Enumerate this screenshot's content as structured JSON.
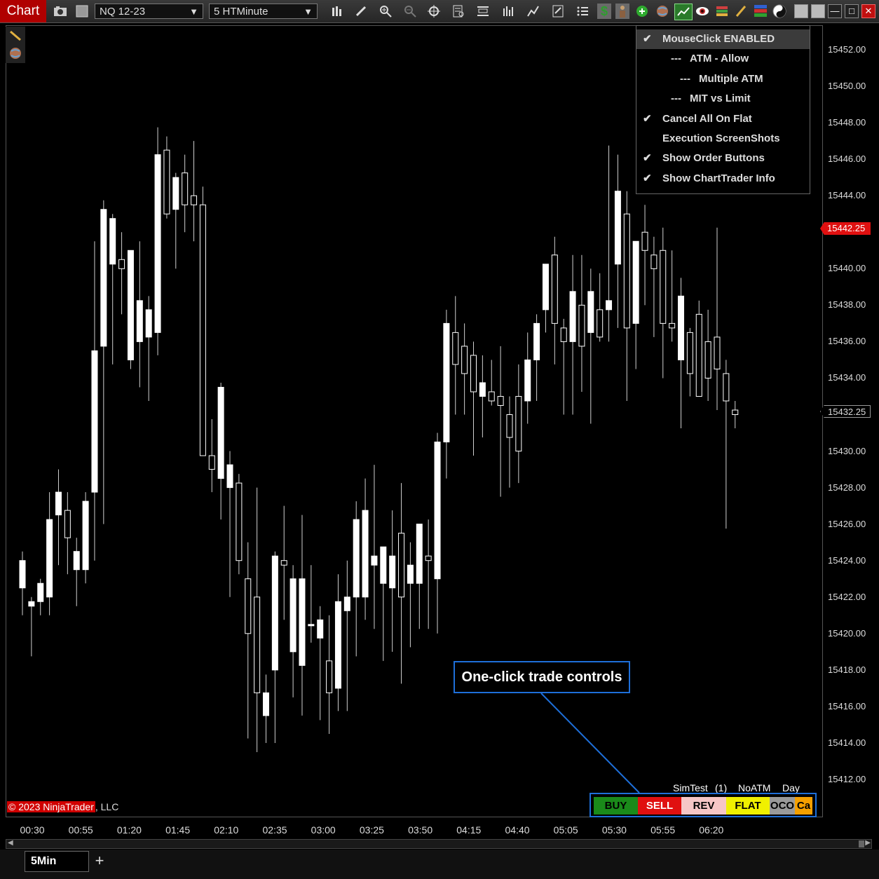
{
  "window": {
    "title": "Chart"
  },
  "toolbar": {
    "instrument": "NQ 12-23",
    "interval": "5 HTMinute",
    "icons": [
      "camera-icon",
      "square-icon",
      "bars-style-icon",
      "drawing-pencil-icon",
      "zoom-in-icon",
      "zoom-out-icon",
      "crosshair-icon",
      "data-box-icon",
      "properties-icon",
      "indicators-icon",
      "strategies-icon",
      "templates-icon",
      "order-list-icon",
      "money-icon",
      "trader-icon",
      "add-icon",
      "globe-icon",
      "chart-icon",
      "eye-icon",
      "pencil-icon",
      "bars-color-icon",
      "stack-icon",
      "yinyang-icon"
    ]
  },
  "menu": {
    "items": [
      {
        "label": "MouseClick ENABLED",
        "prefix": "",
        "checked": true
      },
      {
        "label": "ATM - Allow",
        "prefix": "---",
        "checked": false
      },
      {
        "label": "Multiple ATM",
        "prefix": "---",
        "checked": false
      },
      {
        "label": "MIT vs Limit",
        "prefix": "---",
        "checked": false
      },
      {
        "label": "Cancel All On Flat",
        "prefix": "",
        "checked": true
      },
      {
        "label": "Execution ScreenShots",
        "prefix": "",
        "checked": false
      },
      {
        "label": "Show Order Buttons",
        "prefix": "",
        "checked": true
      },
      {
        "label": "Show ChartTrader Info",
        "prefix": "",
        "checked": true
      }
    ]
  },
  "chart_data": {
    "type": "candlestick",
    "instrument": "NQ 12-23",
    "interval": "5 HTMinute",
    "yaxis_ticks": [
      "15452.00",
      "15450.00",
      "15448.00",
      "15446.00",
      "15444.00",
      "15442.00",
      "15440.00",
      "15438.00",
      "15436.00",
      "15434.00",
      "15432.00",
      "15430.00",
      "15428.00",
      "15426.00",
      "15424.00",
      "15422.00",
      "15420.00",
      "15418.00",
      "15416.00",
      "15414.00",
      "15412.00"
    ],
    "xaxis_ticks": [
      "00:30",
      "00:55",
      "01:20",
      "01:45",
      "02:10",
      "02:35",
      "03:00",
      "03:25",
      "03:50",
      "04:15",
      "04:40",
      "05:05",
      "05:30",
      "05:55",
      "06:20"
    ],
    "ylim": [
      15410.5,
      15453.5
    ],
    "price_markers": [
      {
        "label": "15442.25",
        "color": "#e00000"
      },
      {
        "label": "15432.25",
        "color": "#000000"
      }
    ],
    "candles": [
      {
        "o": 15422.5,
        "h": 15424.5,
        "l": 15421.0,
        "c": 15424.0
      },
      {
        "o": 15421.5,
        "h": 15422.0,
        "l": 15418.75,
        "c": 15421.75
      },
      {
        "o": 15421.75,
        "h": 15423.0,
        "l": 15421.0,
        "c": 15422.75
      },
      {
        "o": 15422.0,
        "h": 15427.75,
        "l": 15421.0,
        "c": 15426.25
      },
      {
        "o": 15426.5,
        "h": 15429.0,
        "l": 15423.75,
        "c": 15427.75
      },
      {
        "o": 15426.75,
        "h": 15427.75,
        "l": 15423.25,
        "c": 15425.25
      },
      {
        "o": 15423.5,
        "h": 15425.25,
        "l": 15421.5,
        "c": 15424.5
      },
      {
        "o": 15423.5,
        "h": 15427.75,
        "l": 15422.75,
        "c": 15427.25
      },
      {
        "o": 15427.75,
        "h": 15441.5,
        "l": 15424.0,
        "c": 15435.5
      },
      {
        "o": 15435.75,
        "h": 15443.75,
        "l": 15426.0,
        "c": 15443.25
      },
      {
        "o": 15440.25,
        "h": 15443.0,
        "l": 15434.75,
        "c": 15442.75
      },
      {
        "o": 15440.5,
        "h": 15442.0,
        "l": 15437.5,
        "c": 15440.0
      },
      {
        "o": 15435.0,
        "h": 15441.0,
        "l": 15434.5,
        "c": 15441.0
      },
      {
        "o": 15436.0,
        "h": 15441.5,
        "l": 15433.5,
        "c": 15438.25
      },
      {
        "o": 15436.25,
        "h": 15438.5,
        "l": 15432.75,
        "c": 15437.75
      },
      {
        "o": 15436.5,
        "h": 15447.75,
        "l": 15435.25,
        "c": 15446.25
      },
      {
        "o": 15446.5,
        "h": 15447.25,
        "l": 15442.75,
        "c": 15443.0
      },
      {
        "o": 15443.25,
        "h": 15445.25,
        "l": 15440.0,
        "c": 15445.0
      },
      {
        "o": 15445.25,
        "h": 15446.25,
        "l": 15442.0,
        "c": 15443.5
      },
      {
        "o": 15444.0,
        "h": 15447.0,
        "l": 15441.5,
        "c": 15443.5
      },
      {
        "o": 15443.5,
        "h": 15444.5,
        "l": 15431.75,
        "c": 15429.75
      },
      {
        "o": 15429.75,
        "h": 15431.75,
        "l": 15427.75,
        "c": 15429.0
      },
      {
        "o": 15428.5,
        "h": 15433.75,
        "l": 15426.25,
        "c": 15433.5
      },
      {
        "o": 15428.0,
        "h": 15430.0,
        "l": 15422.0,
        "c": 15429.25
      },
      {
        "o": 15428.25,
        "h": 15428.75,
        "l": 15423.25,
        "c": 15424.0
      },
      {
        "o": 15423.0,
        "h": 15425.0,
        "l": 15414.25,
        "c": 15420.0
      },
      {
        "o": 15422.0,
        "h": 15428.0,
        "l": 15413.5,
        "c": 15416.75
      },
      {
        "o": 15415.5,
        "h": 15417.75,
        "l": 15414.0,
        "c": 15416.75
      },
      {
        "o": 15418.0,
        "h": 15424.5,
        "l": 15414.0,
        "c": 15424.25
      },
      {
        "o": 15424.0,
        "h": 15427.0,
        "l": 15420.75,
        "c": 15423.75
      },
      {
        "o": 15419.0,
        "h": 15423.75,
        "l": 15416.5,
        "c": 15423.0
      },
      {
        "o": 15418.25,
        "h": 15426.5,
        "l": 15415.5,
        "c": 15423.0
      },
      {
        "o": 15420.5,
        "h": 15423.75,
        "l": 15419.5,
        "c": 15420.5
      },
      {
        "o": 15419.75,
        "h": 15421.5,
        "l": 15415.25,
        "c": 15420.75
      },
      {
        "o": 15418.5,
        "h": 15421.0,
        "l": 15414.5,
        "c": 15416.75
      },
      {
        "o": 15417.0,
        "h": 15423.25,
        "l": 15415.75,
        "c": 15421.75
      },
      {
        "o": 15421.25,
        "h": 15424.0,
        "l": 15415.75,
        "c": 15422.0
      },
      {
        "o": 15422.0,
        "h": 15427.25,
        "l": 15418.75,
        "c": 15426.25
      },
      {
        "o": 15422.0,
        "h": 15428.5,
        "l": 15420.75,
        "c": 15426.75
      },
      {
        "o": 15423.75,
        "h": 15429.25,
        "l": 15420.25,
        "c": 15424.25
      },
      {
        "o": 15422.75,
        "h": 15423.75,
        "l": 15418.5,
        "c": 15424.75
      },
      {
        "o": 15422.5,
        "h": 15426.75,
        "l": 15419.0,
        "c": 15424.25
      },
      {
        "o": 15425.5,
        "h": 15428.25,
        "l": 15417.25,
        "c": 15422.0
      },
      {
        "o": 15422.75,
        "h": 15425.0,
        "l": 15419.25,
        "c": 15423.75
      },
      {
        "o": 15422.75,
        "h": 15426.0,
        "l": 15420.25,
        "c": 15426.0
      },
      {
        "o": 15424.25,
        "h": 15426.25,
        "l": 15420.25,
        "c": 15424.0
      },
      {
        "o": 15423.0,
        "h": 15431.0,
        "l": 15420.0,
        "c": 15430.5
      },
      {
        "o": 15430.5,
        "h": 15437.75,
        "l": 15428.5,
        "c": 15437.0
      },
      {
        "o": 15436.5,
        "h": 15438.5,
        "l": 15432.0,
        "c": 15434.75
      },
      {
        "o": 15435.75,
        "h": 15437.0,
        "l": 15432.0,
        "c": 15434.25
      },
      {
        "o": 15435.25,
        "h": 15436.0,
        "l": 15429.75,
        "c": 15433.25
      },
      {
        "o": 15433.0,
        "h": 15435.25,
        "l": 15430.75,
        "c": 15433.75
      },
      {
        "o": 15433.25,
        "h": 15435.0,
        "l": 15432.5,
        "c": 15432.75
      },
      {
        "o": 15433.0,
        "h": 15435.75,
        "l": 15427.5,
        "c": 15432.5
      },
      {
        "o": 15432.0,
        "h": 15433.0,
        "l": 15428.0,
        "c": 15430.75
      },
      {
        "o": 15433.0,
        "h": 15434.75,
        "l": 15428.25,
        "c": 15430.0
      },
      {
        "o": 15432.75,
        "h": 15436.5,
        "l": 15431.5,
        "c": 15435.0
      },
      {
        "o": 15435.0,
        "h": 15437.5,
        "l": 15432.75,
        "c": 15437.0
      },
      {
        "o": 15437.75,
        "h": 15440.25,
        "l": 15436.5,
        "c": 15440.25
      },
      {
        "o": 15440.75,
        "h": 15441.75,
        "l": 15434.75,
        "c": 15437.0
      },
      {
        "o": 15436.75,
        "h": 15437.25,
        "l": 15432.0,
        "c": 15436.0
      },
      {
        "o": 15436.0,
        "h": 15440.75,
        "l": 15432.0,
        "c": 15438.75
      },
      {
        "o": 15438.0,
        "h": 15440.75,
        "l": 15433.25,
        "c": 15435.75
      },
      {
        "o": 15436.5,
        "h": 15440.0,
        "l": 15431.5,
        "c": 15438.75
      },
      {
        "o": 15437.75,
        "h": 15439.75,
        "l": 15436.0,
        "c": 15436.25
      },
      {
        "o": 15437.75,
        "h": 15446.75,
        "l": 15436.0,
        "c": 15438.25
      },
      {
        "o": 15440.25,
        "h": 15446.25,
        "l": 15436.75,
        "c": 15444.25
      },
      {
        "o": 15443.0,
        "h": 15444.25,
        "l": 15432.75,
        "c": 15436.75
      },
      {
        "o": 15437.0,
        "h": 15441.5,
        "l": 15434.5,
        "c": 15441.5
      },
      {
        "o": 15442.0,
        "h": 15443.5,
        "l": 15438.0,
        "c": 15441.0
      },
      {
        "o": 15440.75,
        "h": 15441.75,
        "l": 15436.25,
        "c": 15440.0
      },
      {
        "o": 15441.0,
        "h": 15442.25,
        "l": 15434.0,
        "c": 15437.0
      },
      {
        "o": 15437.0,
        "h": 15441.0,
        "l": 15436.0,
        "c": 15436.75
      },
      {
        "o": 15435.0,
        "h": 15439.5,
        "l": 15431.25,
        "c": 15438.5
      },
      {
        "o": 15436.5,
        "h": 15436.75,
        "l": 15433.0,
        "c": 15434.25
      },
      {
        "o": 15437.5,
        "h": 15438.25,
        "l": 15433.75,
        "c": 15433.0
      },
      {
        "o": 15436.0,
        "h": 15437.75,
        "l": 15432.75,
        "c": 15434.0
      },
      {
        "o": 15436.25,
        "h": 15442.25,
        "l": 15432.25,
        "c": 15434.5
      },
      {
        "o": 15434.25,
        "h": 15435.0,
        "l": 15425.75,
        "c": 15432.75
      },
      {
        "o": 15432.25,
        "h": 15432.75,
        "l": 15431.25,
        "c": 15432.0
      }
    ]
  },
  "status": {
    "account": "SimTest",
    "position": "(1)",
    "atm": "NoATM",
    "tif": "Day"
  },
  "order_buttons": {
    "buy": "BUY",
    "sell": "SELL",
    "rev": "REV",
    "flat": "FLAT",
    "oco": "OCO",
    "cancel": "Ca"
  },
  "callout": {
    "text": "One-click trade controls"
  },
  "copyright": {
    "brand": "© 2023 NinjaTrader",
    "suffix": ", LLC"
  },
  "tabs": [
    {
      "label": "5Min"
    }
  ]
}
